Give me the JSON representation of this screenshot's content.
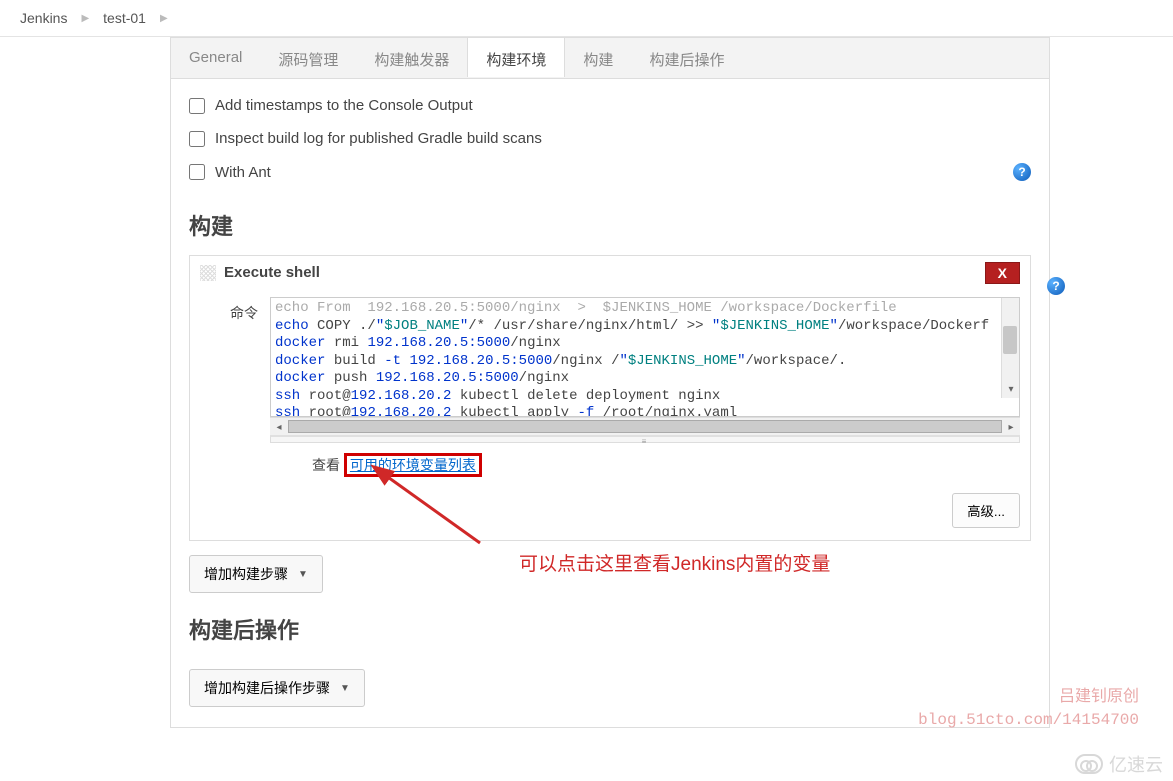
{
  "breadcrumbs": {
    "root": "Jenkins",
    "job": "test-01"
  },
  "tabs": {
    "general": "General",
    "scm": "源码管理",
    "triggers": "构建触发器",
    "env": "构建环境",
    "build": "构建",
    "post": "构建后操作"
  },
  "env_checks": {
    "timestamps": "Add timestamps to the Console Output",
    "gradle_scans": "Inspect build log for published Gradle build scans",
    "with_ant": "With Ant"
  },
  "section_build": "构建",
  "section_post": "构建后操作",
  "step": {
    "title": "Execute shell",
    "close": "X",
    "command_label": "命令",
    "code_lines": [
      {
        "prefix_cut": "echo From  192.168.20.5:5000/nginx  >  $JENKINS_HOME /workspace/Dockerfile"
      },
      {
        "raw": "echo COPY ./\"$JOB_NAME\"/* /usr/share/nginx/html/ >> \"$JENKINS_HOME\"/workspace/Dockerf"
      },
      {
        "raw": "docker rmi 192.168.20.5:5000/nginx"
      },
      {
        "raw": "docker build -t 192.168.20.5:5000/nginx /\"$JENKINS_HOME\"/workspace/."
      },
      {
        "raw": "docker push 192.168.20.5:5000/nginx"
      },
      {
        "raw": "ssh root@192.168.20.2 kubectl delete deployment nginx"
      },
      {
        "raw": "ssh root@192.168.20.2 kubectl apply -f /root/nginx.yaml"
      }
    ],
    "see_prefix": "查看 ",
    "see_link": "可用的环境变量列表",
    "advanced": "高级..."
  },
  "add_build_step": "增加构建步骤",
  "add_post_step": "增加构建后操作步骤",
  "annotation": "可以点击这里查看Jenkins内置的变量",
  "watermark1_l1": "吕建钊原创",
  "watermark1_l2": "blog.51cto.com/14154700",
  "watermark2": "亿速云"
}
